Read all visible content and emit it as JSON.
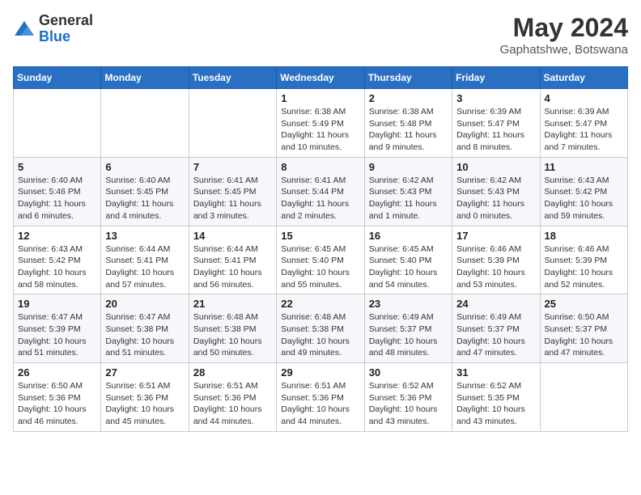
{
  "header": {
    "logo_general": "General",
    "logo_blue": "Blue",
    "title": "May 2024",
    "location": "Gaphatshwe, Botswana"
  },
  "days_of_week": [
    "Sunday",
    "Monday",
    "Tuesday",
    "Wednesday",
    "Thursday",
    "Friday",
    "Saturday"
  ],
  "weeks": [
    [
      {
        "day": "",
        "info": ""
      },
      {
        "day": "",
        "info": ""
      },
      {
        "day": "",
        "info": ""
      },
      {
        "day": "1",
        "info": "Sunrise: 6:38 AM\nSunset: 5:49 PM\nDaylight: 11 hours and 10 minutes."
      },
      {
        "day": "2",
        "info": "Sunrise: 6:38 AM\nSunset: 5:48 PM\nDaylight: 11 hours and 9 minutes."
      },
      {
        "day": "3",
        "info": "Sunrise: 6:39 AM\nSunset: 5:47 PM\nDaylight: 11 hours and 8 minutes."
      },
      {
        "day": "4",
        "info": "Sunrise: 6:39 AM\nSunset: 5:47 PM\nDaylight: 11 hours and 7 minutes."
      }
    ],
    [
      {
        "day": "5",
        "info": "Sunrise: 6:40 AM\nSunset: 5:46 PM\nDaylight: 11 hours and 6 minutes."
      },
      {
        "day": "6",
        "info": "Sunrise: 6:40 AM\nSunset: 5:45 PM\nDaylight: 11 hours and 4 minutes."
      },
      {
        "day": "7",
        "info": "Sunrise: 6:41 AM\nSunset: 5:45 PM\nDaylight: 11 hours and 3 minutes."
      },
      {
        "day": "8",
        "info": "Sunrise: 6:41 AM\nSunset: 5:44 PM\nDaylight: 11 hours and 2 minutes."
      },
      {
        "day": "9",
        "info": "Sunrise: 6:42 AM\nSunset: 5:43 PM\nDaylight: 11 hours and 1 minute."
      },
      {
        "day": "10",
        "info": "Sunrise: 6:42 AM\nSunset: 5:43 PM\nDaylight: 11 hours and 0 minutes."
      },
      {
        "day": "11",
        "info": "Sunrise: 6:43 AM\nSunset: 5:42 PM\nDaylight: 10 hours and 59 minutes."
      }
    ],
    [
      {
        "day": "12",
        "info": "Sunrise: 6:43 AM\nSunset: 5:42 PM\nDaylight: 10 hours and 58 minutes."
      },
      {
        "day": "13",
        "info": "Sunrise: 6:44 AM\nSunset: 5:41 PM\nDaylight: 10 hours and 57 minutes."
      },
      {
        "day": "14",
        "info": "Sunrise: 6:44 AM\nSunset: 5:41 PM\nDaylight: 10 hours and 56 minutes."
      },
      {
        "day": "15",
        "info": "Sunrise: 6:45 AM\nSunset: 5:40 PM\nDaylight: 10 hours and 55 minutes."
      },
      {
        "day": "16",
        "info": "Sunrise: 6:45 AM\nSunset: 5:40 PM\nDaylight: 10 hours and 54 minutes."
      },
      {
        "day": "17",
        "info": "Sunrise: 6:46 AM\nSunset: 5:39 PM\nDaylight: 10 hours and 53 minutes."
      },
      {
        "day": "18",
        "info": "Sunrise: 6:46 AM\nSunset: 5:39 PM\nDaylight: 10 hours and 52 minutes."
      }
    ],
    [
      {
        "day": "19",
        "info": "Sunrise: 6:47 AM\nSunset: 5:39 PM\nDaylight: 10 hours and 51 minutes."
      },
      {
        "day": "20",
        "info": "Sunrise: 6:47 AM\nSunset: 5:38 PM\nDaylight: 10 hours and 51 minutes."
      },
      {
        "day": "21",
        "info": "Sunrise: 6:48 AM\nSunset: 5:38 PM\nDaylight: 10 hours and 50 minutes."
      },
      {
        "day": "22",
        "info": "Sunrise: 6:48 AM\nSunset: 5:38 PM\nDaylight: 10 hours and 49 minutes."
      },
      {
        "day": "23",
        "info": "Sunrise: 6:49 AM\nSunset: 5:37 PM\nDaylight: 10 hours and 48 minutes."
      },
      {
        "day": "24",
        "info": "Sunrise: 6:49 AM\nSunset: 5:37 PM\nDaylight: 10 hours and 47 minutes."
      },
      {
        "day": "25",
        "info": "Sunrise: 6:50 AM\nSunset: 5:37 PM\nDaylight: 10 hours and 47 minutes."
      }
    ],
    [
      {
        "day": "26",
        "info": "Sunrise: 6:50 AM\nSunset: 5:36 PM\nDaylight: 10 hours and 46 minutes."
      },
      {
        "day": "27",
        "info": "Sunrise: 6:51 AM\nSunset: 5:36 PM\nDaylight: 10 hours and 45 minutes."
      },
      {
        "day": "28",
        "info": "Sunrise: 6:51 AM\nSunset: 5:36 PM\nDaylight: 10 hours and 44 minutes."
      },
      {
        "day": "29",
        "info": "Sunrise: 6:51 AM\nSunset: 5:36 PM\nDaylight: 10 hours and 44 minutes."
      },
      {
        "day": "30",
        "info": "Sunrise: 6:52 AM\nSunset: 5:36 PM\nDaylight: 10 hours and 43 minutes."
      },
      {
        "day": "31",
        "info": "Sunrise: 6:52 AM\nSunset: 5:35 PM\nDaylight: 10 hours and 43 minutes."
      },
      {
        "day": "",
        "info": ""
      }
    ]
  ]
}
